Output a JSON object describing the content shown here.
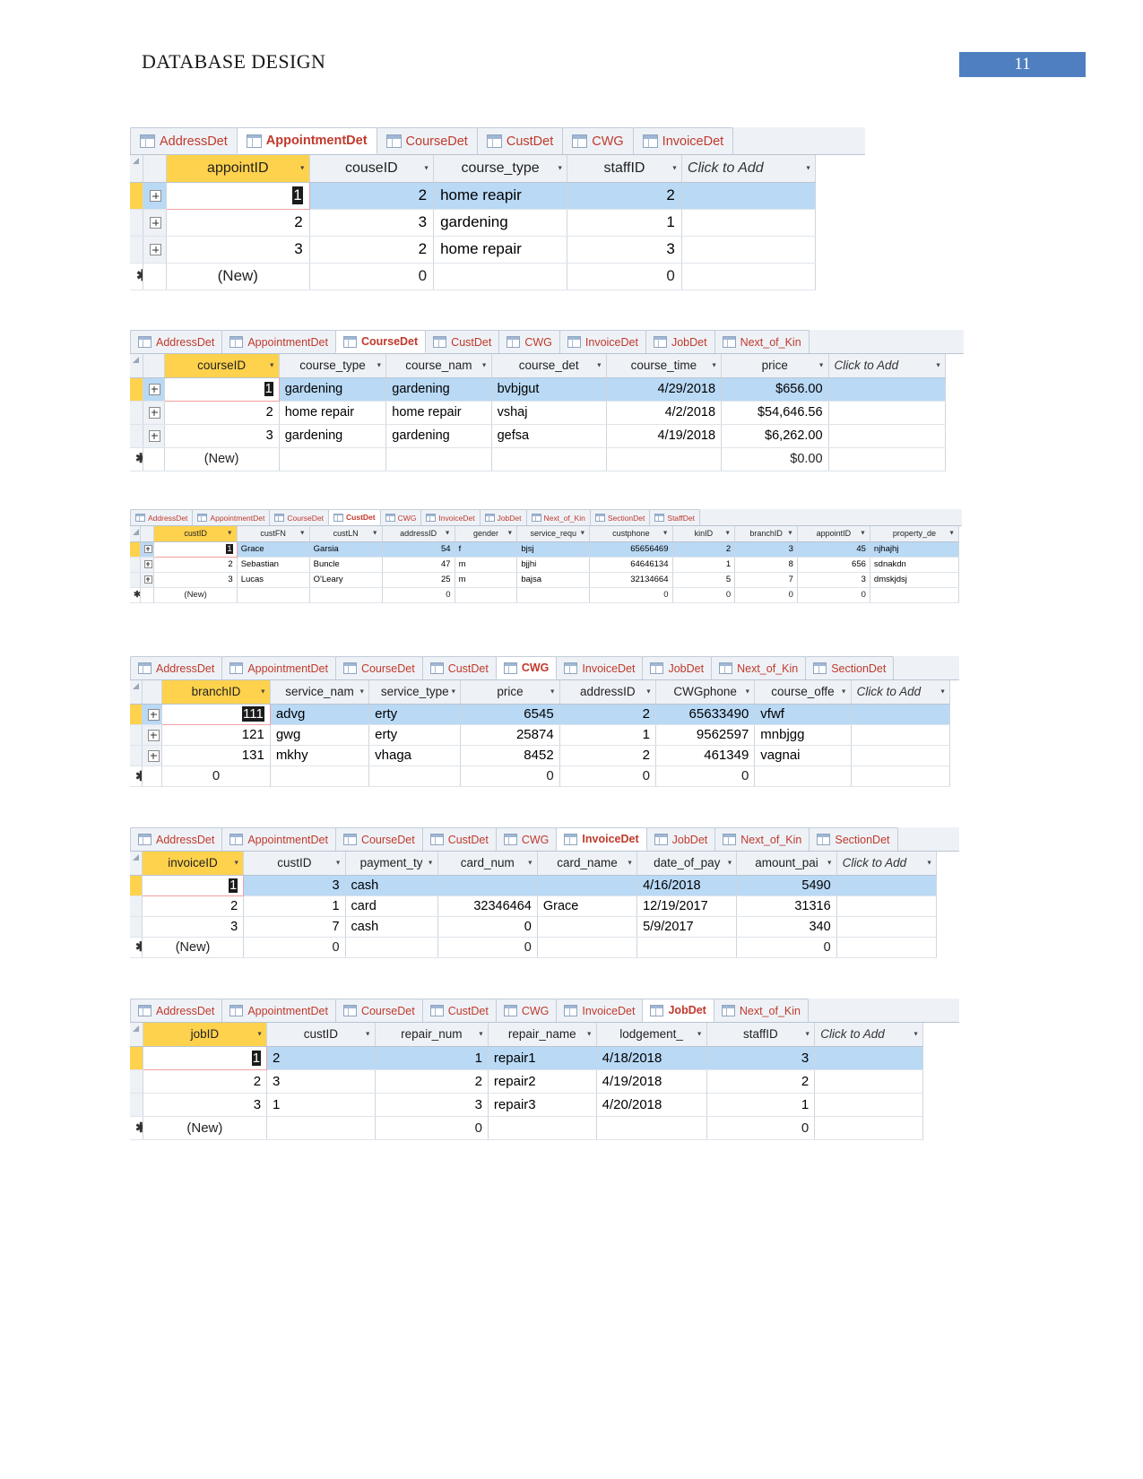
{
  "document": {
    "title": "DATABASE DESIGN",
    "page_number": "11",
    "page_number_bg": "#4f7fc0"
  },
  "icons": {
    "table": "table-icon",
    "expand": "expand-plus-icon",
    "new_record": "new-record-asterisk-icon",
    "dropdown": "chevron-down-icon"
  },
  "labels": {
    "click_to_add": "Click to Add",
    "new_row": "(New)",
    "star": "✱"
  },
  "tables": [
    {
      "id": "appointment",
      "tabs": [
        {
          "label": "AddressDet",
          "active": false
        },
        {
          "label": "AppointmentDet",
          "active": true
        },
        {
          "label": "CourseDet",
          "active": false
        },
        {
          "label": "CustDet",
          "active": false
        },
        {
          "label": "CWG",
          "active": false
        },
        {
          "label": "InvoiceDet",
          "active": false
        }
      ],
      "columns": [
        "appointID",
        "couseID",
        "course_type",
        "staffID",
        "Click to Add"
      ],
      "rows": [
        {
          "selected": true,
          "editing": true,
          "cells": [
            "1",
            "2",
            "home reapir",
            "2",
            ""
          ]
        },
        {
          "selected": false,
          "editing": false,
          "cells": [
            "2",
            "3",
            "gardening",
            "1",
            ""
          ]
        },
        {
          "selected": false,
          "editing": false,
          "cells": [
            "3",
            "2",
            "home repair",
            "3",
            ""
          ]
        }
      ],
      "new_row": [
        "(New)",
        "0",
        "",
        "0",
        ""
      ]
    },
    {
      "id": "course",
      "tabs": [
        {
          "label": "AddressDet",
          "active": false
        },
        {
          "label": "AppointmentDet",
          "active": false
        },
        {
          "label": "CourseDet",
          "active": true
        },
        {
          "label": "CustDet",
          "active": false
        },
        {
          "label": "CWG",
          "active": false
        },
        {
          "label": "InvoiceDet",
          "active": false
        },
        {
          "label": "JobDet",
          "active": false
        },
        {
          "label": "Next_of_Kin",
          "active": false
        }
      ],
      "columns": [
        "courseID",
        "course_type",
        "course_nam",
        "course_det",
        "course_time",
        "price",
        "Click to Add"
      ],
      "rows": [
        {
          "selected": true,
          "editing": true,
          "cells": [
            "1",
            "gardening",
            "gardening",
            "bvbjgut",
            "4/29/2018",
            "$656.00",
            ""
          ]
        },
        {
          "selected": false,
          "editing": false,
          "cells": [
            "2",
            "home repair",
            "home repair",
            "vshaj",
            "4/2/2018",
            "$54,646.56",
            ""
          ]
        },
        {
          "selected": false,
          "editing": false,
          "cells": [
            "3",
            "gardening",
            "gardening",
            "gefsa",
            "4/19/2018",
            "$6,262.00",
            ""
          ]
        }
      ],
      "new_row": [
        "(New)",
        "",
        "",
        "",
        "",
        "$0.00",
        ""
      ]
    },
    {
      "id": "cust",
      "tabs": [
        {
          "label": "AddressDet",
          "active": false
        },
        {
          "label": "AppointmentDet",
          "active": false
        },
        {
          "label": "CourseDet",
          "active": false
        },
        {
          "label": "CustDet",
          "active": true
        },
        {
          "label": "CWG",
          "active": false
        },
        {
          "label": "InvoiceDet",
          "active": false
        },
        {
          "label": "JobDet",
          "active": false
        },
        {
          "label": "Next_of_Kin",
          "active": false
        },
        {
          "label": "SectionDet",
          "active": false
        },
        {
          "label": "StaffDet",
          "active": false
        }
      ],
      "columns": [
        "custID",
        "custFN",
        "custLN",
        "addressID",
        "gender",
        "service_requ",
        "custphone",
        "kinID",
        "branchID",
        "appointID",
        "property_de"
      ],
      "rows": [
        {
          "selected": true,
          "editing": true,
          "cells": [
            "1",
            "Grace",
            "Garsia",
            "54",
            "f",
            "bjsj",
            "65656469",
            "2",
            "3",
            "45",
            "njhajhj"
          ]
        },
        {
          "selected": false,
          "editing": false,
          "cells": [
            "2",
            "Sebastian",
            "Buncle",
            "47",
            "m",
            "bjjhi",
            "64646134",
            "1",
            "8",
            "656",
            "sdnakdn"
          ]
        },
        {
          "selected": false,
          "editing": false,
          "cells": [
            "3",
            "Lucas",
            "O'Leary",
            "25",
            "m",
            "bajsa",
            "32134664",
            "5",
            "7",
            "3",
            "dmskjdsj"
          ]
        }
      ],
      "new_row": [
        "(New)",
        "",
        "",
        "0",
        "",
        "",
        "0",
        "0",
        "0",
        "0",
        ""
      ]
    },
    {
      "id": "cwg",
      "tabs": [
        {
          "label": "AddressDet",
          "active": false
        },
        {
          "label": "AppointmentDet",
          "active": false
        },
        {
          "label": "CourseDet",
          "active": false
        },
        {
          "label": "CustDet",
          "active": false
        },
        {
          "label": "CWG",
          "active": true
        },
        {
          "label": "InvoiceDet",
          "active": false
        },
        {
          "label": "JobDet",
          "active": false
        },
        {
          "label": "Next_of_Kin",
          "active": false
        },
        {
          "label": "SectionDet",
          "active": false
        }
      ],
      "columns": [
        "branchID",
        "service_nam",
        "service_type",
        "price",
        "addressID",
        "CWGphone",
        "course_offe",
        "Click to Add"
      ],
      "rows": [
        {
          "selected": true,
          "editing": true,
          "cells": [
            "111",
            "advg",
            "erty",
            "6545",
            "2",
            "65633490",
            "vfwf",
            ""
          ]
        },
        {
          "selected": false,
          "editing": false,
          "cells": [
            "121",
            "gwg",
            "erty",
            "25874",
            "1",
            "9562597",
            "mnbjgg",
            ""
          ]
        },
        {
          "selected": false,
          "editing": false,
          "cells": [
            "131",
            "mkhy",
            "vhaga",
            "8452",
            "2",
            "461349",
            "vagnai",
            ""
          ]
        }
      ],
      "new_row": [
        "0",
        "",
        "",
        "0",
        "0",
        "0",
        "",
        ""
      ]
    },
    {
      "id": "invoice",
      "tabs": [
        {
          "label": "AddressDet",
          "active": false
        },
        {
          "label": "AppointmentDet",
          "active": false
        },
        {
          "label": "CourseDet",
          "active": false
        },
        {
          "label": "CustDet",
          "active": false
        },
        {
          "label": "CWG",
          "active": false
        },
        {
          "label": "InvoiceDet",
          "active": true
        },
        {
          "label": "JobDet",
          "active": false
        },
        {
          "label": "Next_of_Kin",
          "active": false
        },
        {
          "label": "SectionDet",
          "active": false
        }
      ],
      "columns": [
        "invoiceID",
        "custID",
        "payment_ty",
        "card_num",
        "card_name",
        "date_of_pay",
        "amount_pai",
        "Click to Add"
      ],
      "rows": [
        {
          "selected": true,
          "editing": true,
          "cells": [
            "1",
            "3",
            "cash",
            "",
            "",
            "4/16/2018",
            "5490",
            ""
          ]
        },
        {
          "selected": false,
          "editing": false,
          "cells": [
            "2",
            "1",
            "card",
            "32346464",
            "Grace",
            "12/19/2017",
            "31316",
            ""
          ]
        },
        {
          "selected": false,
          "editing": false,
          "cells": [
            "3",
            "7",
            "cash",
            "0",
            "",
            "5/9/2017",
            "340",
            ""
          ]
        }
      ],
      "new_row": [
        "(New)",
        "0",
        "",
        "0",
        "",
        "",
        "0",
        ""
      ]
    },
    {
      "id": "job",
      "tabs": [
        {
          "label": "AddressDet",
          "active": false
        },
        {
          "label": "AppointmentDet",
          "active": false
        },
        {
          "label": "CourseDet",
          "active": false
        },
        {
          "label": "CustDet",
          "active": false
        },
        {
          "label": "CWG",
          "active": false
        },
        {
          "label": "InvoiceDet",
          "active": false
        },
        {
          "label": "JobDet",
          "active": true
        },
        {
          "label": "Next_of_Kin",
          "active": false
        }
      ],
      "columns": [
        "jobID",
        "custID",
        "repair_num",
        "repair_name",
        "lodgement_",
        "staffID",
        "Click to Add"
      ],
      "rows": [
        {
          "selected": true,
          "editing": true,
          "cells": [
            "1",
            "2",
            "1",
            "repair1",
            "4/18/2018",
            "3",
            ""
          ]
        },
        {
          "selected": false,
          "editing": false,
          "cells": [
            "2",
            "3",
            "2",
            "repair2",
            "4/19/2018",
            "2",
            ""
          ]
        },
        {
          "selected": false,
          "editing": false,
          "cells": [
            "3",
            "1",
            "3",
            "repair3",
            "4/20/2018",
            "1",
            ""
          ]
        }
      ],
      "new_row": [
        "(New)",
        "",
        "0",
        "",
        "",
        "0",
        ""
      ]
    }
  ]
}
